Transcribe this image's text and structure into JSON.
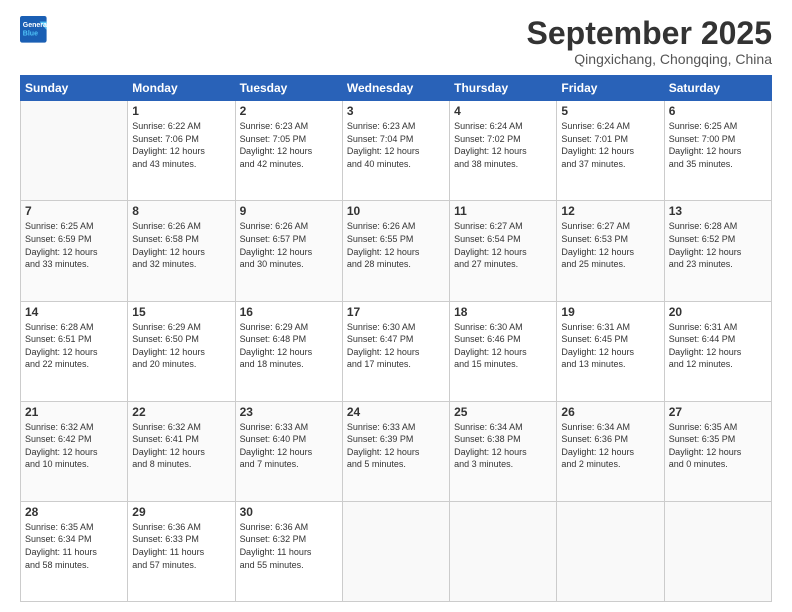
{
  "header": {
    "logo_line1": "General",
    "logo_line2": "Blue",
    "title": "September 2025",
    "subtitle": "Qingxichang, Chongqing, China"
  },
  "calendar": {
    "days_of_week": [
      "Sunday",
      "Monday",
      "Tuesday",
      "Wednesday",
      "Thursday",
      "Friday",
      "Saturday"
    ],
    "weeks": [
      [
        {
          "day": "",
          "info": ""
        },
        {
          "day": "1",
          "info": "Sunrise: 6:22 AM\nSunset: 7:06 PM\nDaylight: 12 hours\nand 43 minutes."
        },
        {
          "day": "2",
          "info": "Sunrise: 6:23 AM\nSunset: 7:05 PM\nDaylight: 12 hours\nand 42 minutes."
        },
        {
          "day": "3",
          "info": "Sunrise: 6:23 AM\nSunset: 7:04 PM\nDaylight: 12 hours\nand 40 minutes."
        },
        {
          "day": "4",
          "info": "Sunrise: 6:24 AM\nSunset: 7:02 PM\nDaylight: 12 hours\nand 38 minutes."
        },
        {
          "day": "5",
          "info": "Sunrise: 6:24 AM\nSunset: 7:01 PM\nDaylight: 12 hours\nand 37 minutes."
        },
        {
          "day": "6",
          "info": "Sunrise: 6:25 AM\nSunset: 7:00 PM\nDaylight: 12 hours\nand 35 minutes."
        }
      ],
      [
        {
          "day": "7",
          "info": "Sunrise: 6:25 AM\nSunset: 6:59 PM\nDaylight: 12 hours\nand 33 minutes."
        },
        {
          "day": "8",
          "info": "Sunrise: 6:26 AM\nSunset: 6:58 PM\nDaylight: 12 hours\nand 32 minutes."
        },
        {
          "day": "9",
          "info": "Sunrise: 6:26 AM\nSunset: 6:57 PM\nDaylight: 12 hours\nand 30 minutes."
        },
        {
          "day": "10",
          "info": "Sunrise: 6:26 AM\nSunset: 6:55 PM\nDaylight: 12 hours\nand 28 minutes."
        },
        {
          "day": "11",
          "info": "Sunrise: 6:27 AM\nSunset: 6:54 PM\nDaylight: 12 hours\nand 27 minutes."
        },
        {
          "day": "12",
          "info": "Sunrise: 6:27 AM\nSunset: 6:53 PM\nDaylight: 12 hours\nand 25 minutes."
        },
        {
          "day": "13",
          "info": "Sunrise: 6:28 AM\nSunset: 6:52 PM\nDaylight: 12 hours\nand 23 minutes."
        }
      ],
      [
        {
          "day": "14",
          "info": "Sunrise: 6:28 AM\nSunset: 6:51 PM\nDaylight: 12 hours\nand 22 minutes."
        },
        {
          "day": "15",
          "info": "Sunrise: 6:29 AM\nSunset: 6:50 PM\nDaylight: 12 hours\nand 20 minutes."
        },
        {
          "day": "16",
          "info": "Sunrise: 6:29 AM\nSunset: 6:48 PM\nDaylight: 12 hours\nand 18 minutes."
        },
        {
          "day": "17",
          "info": "Sunrise: 6:30 AM\nSunset: 6:47 PM\nDaylight: 12 hours\nand 17 minutes."
        },
        {
          "day": "18",
          "info": "Sunrise: 6:30 AM\nSunset: 6:46 PM\nDaylight: 12 hours\nand 15 minutes."
        },
        {
          "day": "19",
          "info": "Sunrise: 6:31 AM\nSunset: 6:45 PM\nDaylight: 12 hours\nand 13 minutes."
        },
        {
          "day": "20",
          "info": "Sunrise: 6:31 AM\nSunset: 6:44 PM\nDaylight: 12 hours\nand 12 minutes."
        }
      ],
      [
        {
          "day": "21",
          "info": "Sunrise: 6:32 AM\nSunset: 6:42 PM\nDaylight: 12 hours\nand 10 minutes."
        },
        {
          "day": "22",
          "info": "Sunrise: 6:32 AM\nSunset: 6:41 PM\nDaylight: 12 hours\nand 8 minutes."
        },
        {
          "day": "23",
          "info": "Sunrise: 6:33 AM\nSunset: 6:40 PM\nDaylight: 12 hours\nand 7 minutes."
        },
        {
          "day": "24",
          "info": "Sunrise: 6:33 AM\nSunset: 6:39 PM\nDaylight: 12 hours\nand 5 minutes."
        },
        {
          "day": "25",
          "info": "Sunrise: 6:34 AM\nSunset: 6:38 PM\nDaylight: 12 hours\nand 3 minutes."
        },
        {
          "day": "26",
          "info": "Sunrise: 6:34 AM\nSunset: 6:36 PM\nDaylight: 12 hours\nand 2 minutes."
        },
        {
          "day": "27",
          "info": "Sunrise: 6:35 AM\nSunset: 6:35 PM\nDaylight: 12 hours\nand 0 minutes."
        }
      ],
      [
        {
          "day": "28",
          "info": "Sunrise: 6:35 AM\nSunset: 6:34 PM\nDaylight: 11 hours\nand 58 minutes."
        },
        {
          "day": "29",
          "info": "Sunrise: 6:36 AM\nSunset: 6:33 PM\nDaylight: 11 hours\nand 57 minutes."
        },
        {
          "day": "30",
          "info": "Sunrise: 6:36 AM\nSunset: 6:32 PM\nDaylight: 11 hours\nand 55 minutes."
        },
        {
          "day": "",
          "info": ""
        },
        {
          "day": "",
          "info": ""
        },
        {
          "day": "",
          "info": ""
        },
        {
          "day": "",
          "info": ""
        }
      ]
    ]
  }
}
